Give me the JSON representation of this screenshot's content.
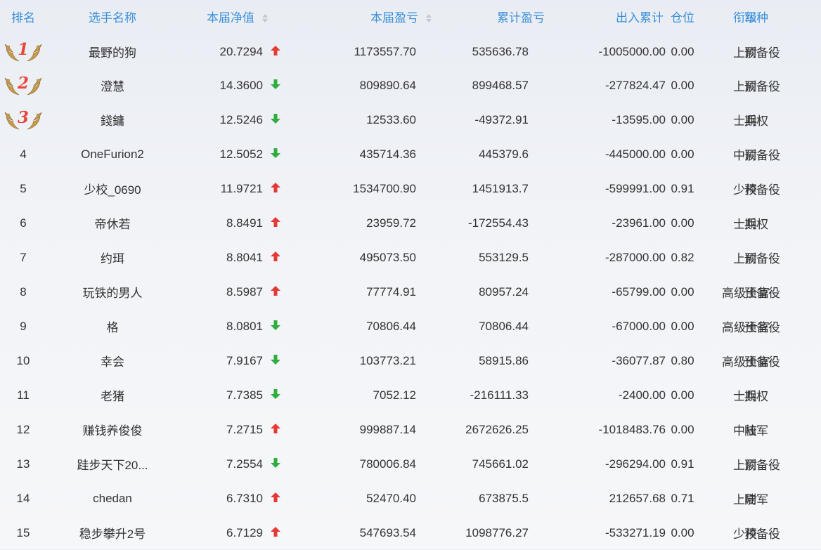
{
  "colors": {
    "header_text": "#3b8fd9",
    "cell_text": "#333333",
    "up_arrow": "#e53935",
    "down_arrow": "#2fae3f",
    "medal_number": "#e8473c",
    "wing": "#c99a4c"
  },
  "header": {
    "rank": "排名",
    "name": "选手名称",
    "nav": "本届净值",
    "profit": "本届盈亏",
    "cum_profit": "累计盈亏",
    "flow": "出入累计",
    "position": "仓位",
    "grade": "衔级",
    "branch": "军种"
  },
  "rows": [
    {
      "rank": "1",
      "medal": true,
      "name": "最野的狗",
      "nav": "20.7294",
      "trend": "up",
      "profit": "1173557.70",
      "cum_profit": "535636.78",
      "flow": "-1005000.00",
      "position": "0.00",
      "grade": "上尉",
      "branch": "预备役"
    },
    {
      "rank": "2",
      "medal": true,
      "name": "澄慧",
      "nav": "14.3600",
      "trend": "down",
      "profit": "809890.64",
      "cum_profit": "899468.57",
      "flow": "-277824.47",
      "position": "0.00",
      "grade": "上尉",
      "branch": "预备役"
    },
    {
      "rank": "3",
      "medal": true,
      "name": "錢鏞",
      "nav": "12.5246",
      "trend": "down",
      "profit": "12533.60",
      "cum_profit": "-49372.91",
      "flow": "-13595.00",
      "position": "0.00",
      "grade": "士兵",
      "branch": "期权"
    },
    {
      "rank": "4",
      "medal": false,
      "name": "OneFurion2",
      "nav": "12.5052",
      "trend": "down",
      "profit": "435714.36",
      "cum_profit": "445379.6",
      "flow": "-445000.00",
      "position": "0.00",
      "grade": "中尉",
      "branch": "预备役"
    },
    {
      "rank": "5",
      "medal": false,
      "name": "少校_0690",
      "nav": "11.9721",
      "trend": "up",
      "profit": "1534700.90",
      "cum_profit": "1451913.7",
      "flow": "-599991.00",
      "position": "0.91",
      "grade": "少校",
      "branch": "预备役"
    },
    {
      "rank": "6",
      "medal": false,
      "name": "帝休若",
      "nav": "8.8491",
      "trend": "up",
      "profit": "23959.72",
      "cum_profit": "-172554.43",
      "flow": "-23961.00",
      "position": "0.00",
      "grade": "士兵",
      "branch": "期权"
    },
    {
      "rank": "7",
      "medal": false,
      "name": "约珥",
      "nav": "8.8041",
      "trend": "up",
      "profit": "495073.50",
      "cum_profit": "553129.5",
      "flow": "-287000.00",
      "position": "0.82",
      "grade": "上尉",
      "branch": "预备役"
    },
    {
      "rank": "8",
      "medal": false,
      "name": "玩铁的男人",
      "nav": "8.5987",
      "trend": "up",
      "profit": "77774.91",
      "cum_profit": "80957.24",
      "flow": "-65799.00",
      "position": "0.00",
      "grade": "高级士官",
      "branch": "预备役"
    },
    {
      "rank": "9",
      "medal": false,
      "name": "格",
      "nav": "8.0801",
      "trend": "down",
      "profit": "70806.44",
      "cum_profit": "70806.44",
      "flow": "-67000.00",
      "position": "0.00",
      "grade": "高级士官",
      "branch": "预备役"
    },
    {
      "rank": "10",
      "medal": false,
      "name": "幸会",
      "nav": "7.9167",
      "trend": "down",
      "profit": "103773.21",
      "cum_profit": "58915.86",
      "flow": "-36077.87",
      "position": "0.80",
      "grade": "高级士官",
      "branch": "预备役"
    },
    {
      "rank": "11",
      "medal": false,
      "name": "老猪",
      "nav": "7.7385",
      "trend": "down",
      "profit": "7052.12",
      "cum_profit": "-216111.33",
      "flow": "-2400.00",
      "position": "0.00",
      "grade": "士兵",
      "branch": "期权"
    },
    {
      "rank": "12",
      "medal": false,
      "name": "赚钱养俊俊",
      "nav": "7.2715",
      "trend": "up",
      "profit": "999887.14",
      "cum_profit": "2672626.25",
      "flow": "-1018483.76",
      "position": "0.00",
      "grade": "中校",
      "branch": "陆军"
    },
    {
      "rank": "13",
      "medal": false,
      "name": "跬步天下20...",
      "nav": "7.2554",
      "trend": "down",
      "profit": "780006.84",
      "cum_profit": "745661.02",
      "flow": "-296294.00",
      "position": "0.91",
      "grade": "上尉",
      "branch": "预备役"
    },
    {
      "rank": "14",
      "medal": false,
      "name": "chedan",
      "nav": "6.7310",
      "trend": "up",
      "profit": "52470.40",
      "cum_profit": "673875.5",
      "flow": "212657.68",
      "position": "0.71",
      "grade": "上尉",
      "branch": "陆军"
    },
    {
      "rank": "15",
      "medal": false,
      "name": "稳步攀升2号",
      "nav": "6.7129",
      "trend": "up",
      "profit": "547693.54",
      "cum_profit": "1098776.27",
      "flow": "-533271.19",
      "position": "0.00",
      "grade": "少校",
      "branch": "预备役"
    }
  ]
}
